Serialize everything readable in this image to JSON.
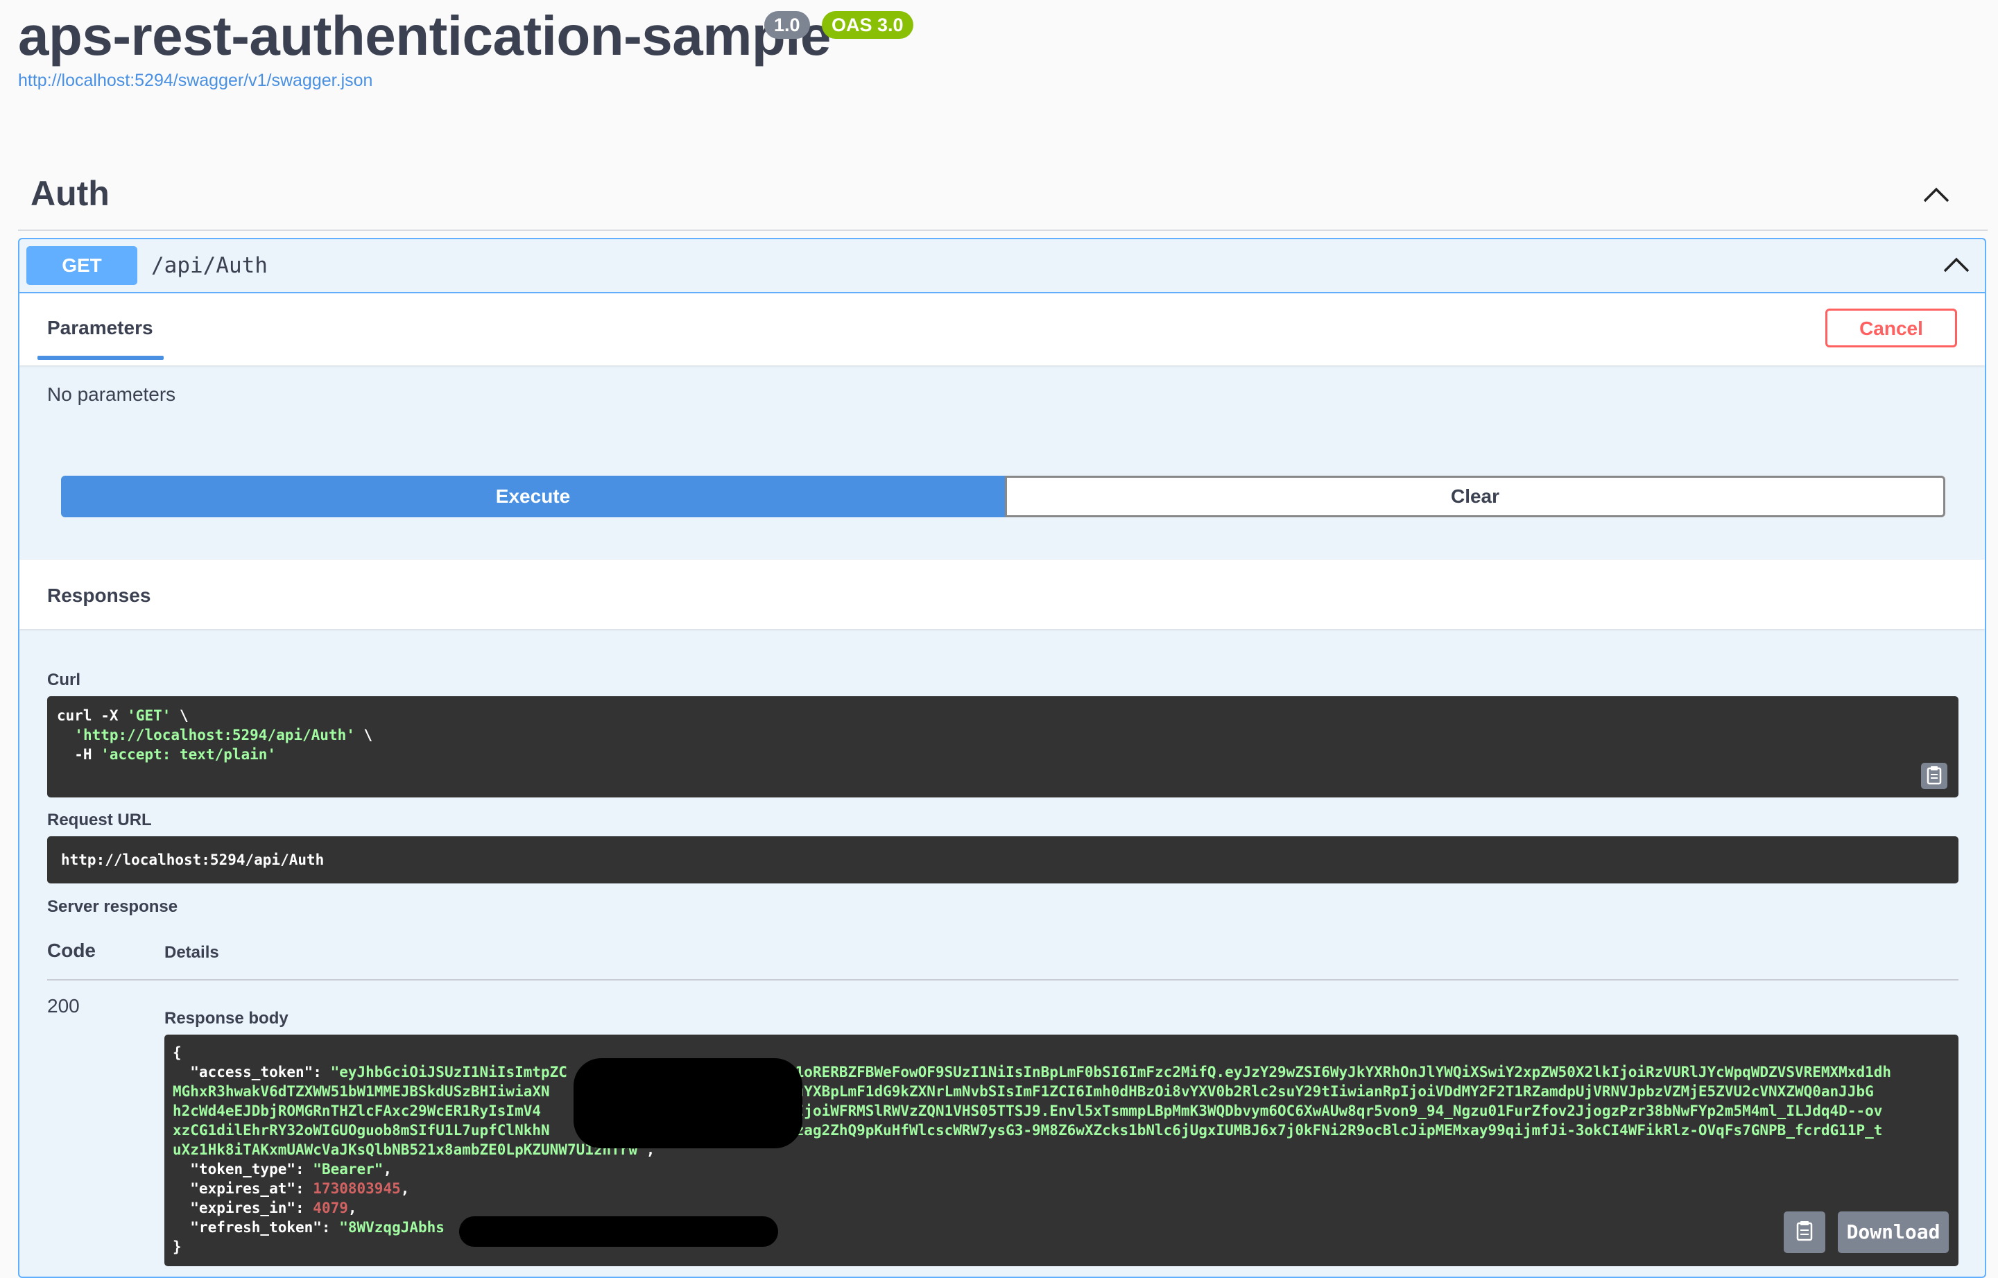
{
  "header": {
    "title": "aps-rest-authentication-sample",
    "version_badge": "1.0",
    "oas_badge": "OAS 3.0",
    "spec_link": "http://localhost:5294/swagger/v1/swagger.json"
  },
  "tag": {
    "name": "Auth"
  },
  "operation": {
    "method": "GET",
    "path": "/api/Auth",
    "parameters_tab": "Parameters",
    "cancel_label": "Cancel",
    "no_parameters": "No parameters",
    "execute_label": "Execute",
    "clear_label": "Clear",
    "responses_title": "Responses"
  },
  "result": {
    "curl_label": "Curl",
    "curl_lines": [
      {
        "plain": "curl -X ",
        "str": "'GET'",
        "tail": " \\"
      },
      {
        "plain": "  ",
        "str": "'http://localhost:5294/api/Auth'",
        "tail": " \\"
      },
      {
        "plain": "  -H ",
        "str": "'accept: text/plain'",
        "tail": ""
      }
    ],
    "request_url_label": "Request URL",
    "request_url": "http://localhost:5294/api/Auth",
    "server_response_label": "Server response",
    "code_header": "Code",
    "details_header": "Details",
    "status_code": "200",
    "response_body_label": "Response body",
    "body": {
      "open": "{",
      "access_token_key": "  \"access_token\": ",
      "access_token_lines": [
        "\"eyJhbGciOiJSUzI1NiIsImtpZC                       ZS01oRERBZFBWeFowOF9SUzI1NiIsInBpLmF0bSI6ImFzc2MifQ.eyJzY29wZSI6WyJkYXRhOnJlYWQiXSwiY2xpZW50X2lkIjoiRzVURlJYcWpqWDZVSVREMXMxd1dh",
        "MGhxR3hwakV6dTZXWW51bW1MMEJBSkdUSzBHIiwiaXN                        wZXIuYXBpLmF1dG9kZXNrLmNvbSIsImF1ZCI6Imh0dHBzOi8vYXV0b2Rlc2suY29tIiwianRpIjoiVDdMY2F2T1RZamdpUjVRNVJpbzVZMjE5ZVU2cVNXZWQ0anJJbG",
        "h2cWd4eEJDbjROMGRnTHZlcFAxc29WcER1RyIsImV4                         cmlkIjoiWFRMSlRWVzZQN1VHS05TTSJ9.Envl5xTsmmpLBpMmK3WQDbvym6OC6XwAUw8qr5von9_94_Ngzu01FurZfov2JjogzPzr38bNwFYp2m5M4ml_ILJdq4D--ov",
        "xzCG1dilEhrRY32oWIGUOguob8mSIfU1L7upfClNkhN                        hmmfzag2ZhQ9pKuHfWlcscWRW7ysG3-9M8Z6wXZcks1bNlc6jUgxIUMBJ6x7j0kFNi2R9ocBlcJipMEMxay99qijmfJi-3okCI4WFikRlz-OVqFs7GNPB_fcrdG11P_t",
        "uXz1Hk8iTAKxmUAWcVaJKsQlbNB521x8ambZE0LpKZUNW7U1zhTrw\""
      ],
      "token_type_key": "  \"token_type\": ",
      "token_type_val": "\"Bearer\"",
      "expires_at_key": "  \"expires_at\": ",
      "expires_at_val": "1730803945",
      "expires_in_key": "  \"expires_in\": ",
      "expires_in_val": "4079",
      "refresh_token_key": "  \"refresh_token\": ",
      "refresh_token_val": "\"8WVzqgJAbhs",
      "close": "}"
    },
    "download_label": "Download"
  },
  "colors": {
    "get_accent": "#61affe",
    "execute_blue": "#4990e2",
    "cancel_red": "#ff6060",
    "oas_green": "#89bf04",
    "version_grey": "#7d8492",
    "code_bg": "#333333",
    "code_string": "#a2fca2",
    "code_number": "#d36363"
  },
  "icons": [
    "chevron-up-icon",
    "clipboard-icon"
  ]
}
